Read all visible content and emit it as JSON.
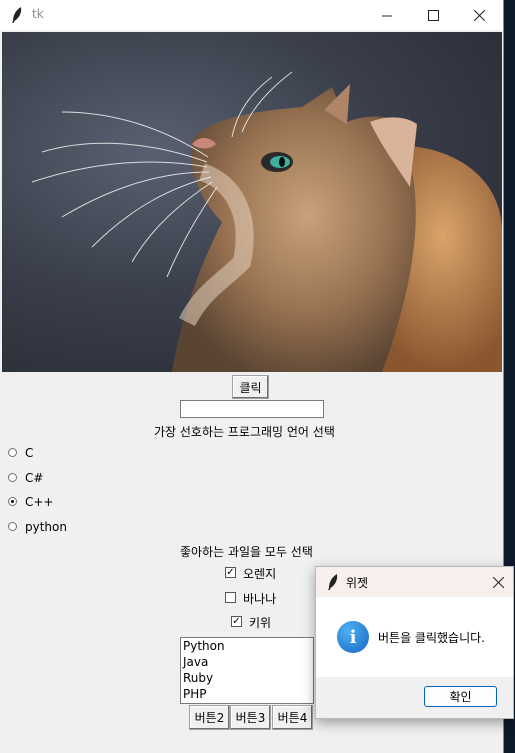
{
  "main_window": {
    "title": "tk",
    "click_button": "클릭",
    "entry_value": "",
    "language_prompt": "가장 선호하는 프로그래밍 언어 선택",
    "languages": [
      {
        "label": "C",
        "selected": false
      },
      {
        "label": "C#",
        "selected": false
      },
      {
        "label": "C++",
        "selected": true
      },
      {
        "label": "python",
        "selected": false
      }
    ],
    "fruit_prompt": "좋아하는 과일을 모두 선택",
    "fruits": [
      {
        "label": "오렌지",
        "checked": true
      },
      {
        "label": "바나나",
        "checked": false
      },
      {
        "label": "키위",
        "checked": true
      }
    ],
    "listbox_items": [
      "Python",
      "Java",
      "Ruby",
      "PHP"
    ],
    "bottom_buttons": [
      "버튼2",
      "버튼3",
      "버튼4"
    ]
  },
  "dialog": {
    "title": "위젯",
    "message": "버튼을 클릭했습니다.",
    "ok_label": "확인",
    "icon": "info-icon"
  },
  "colors": {
    "dialog_accent": "#0067c0",
    "info_icon": "#1e88e5"
  }
}
